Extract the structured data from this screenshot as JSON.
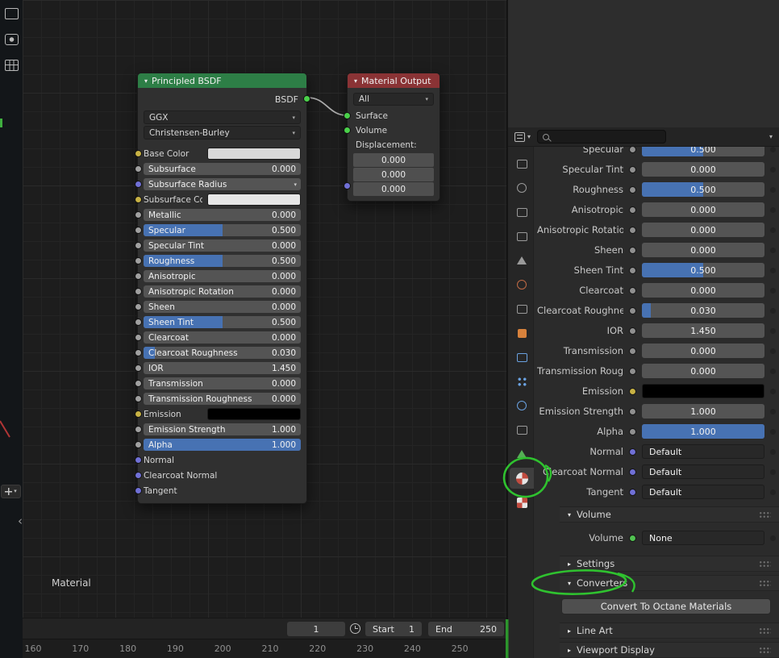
{
  "colors": {
    "accent_blue": "#4772b3",
    "annotation_green": "#2fc22f",
    "node_header_green": "#2d7e46",
    "node_header_red": "#8a3335"
  },
  "left_toolbar": {
    "icons": [
      {
        "name": "printer-icon",
        "shape": "plain"
      },
      {
        "name": "movie-camera-icon",
        "shape": "cam"
      },
      {
        "name": "grid-icon",
        "shape": "grid"
      }
    ]
  },
  "node_editor": {
    "breadcrumb": "Material",
    "principled": {
      "title": "Principled BSDF",
      "output_socket": "BSDF",
      "distribution": "GGX",
      "subsurface_method": "Christensen-Burley",
      "rows": [
        {
          "label": "Base Color",
          "type": "color",
          "swatch": "#d8d8d8",
          "socket": "#c8b244"
        },
        {
          "label": "Subsurface",
          "type": "slider",
          "value": "0.000",
          "fill": 0,
          "socket": "#a0a0a0"
        },
        {
          "label": "Subsurface Radius",
          "type": "vector",
          "socket": "#7070d6"
        },
        {
          "label": "Subsurface Co",
          "type": "color",
          "swatch": "#e6e6e6",
          "socket": "#c8b244"
        },
        {
          "label": "Metallic",
          "type": "slider",
          "value": "0.000",
          "fill": 0,
          "socket": "#a0a0a0"
        },
        {
          "label": "Specular",
          "type": "slider",
          "value": "0.500",
          "fill": 0.5,
          "socket": "#a0a0a0"
        },
        {
          "label": "Specular Tint",
          "type": "slider",
          "value": "0.000",
          "fill": 0,
          "socket": "#a0a0a0"
        },
        {
          "label": "Roughness",
          "type": "slider",
          "value": "0.500",
          "fill": 0.5,
          "socket": "#a0a0a0"
        },
        {
          "label": "Anisotropic",
          "type": "slider",
          "value": "0.000",
          "fill": 0,
          "socket": "#a0a0a0"
        },
        {
          "label": "Anisotropic Rotation",
          "type": "slider",
          "value": "0.000",
          "fill": 0,
          "socket": "#a0a0a0"
        },
        {
          "label": "Sheen",
          "type": "slider",
          "value": "0.000",
          "fill": 0,
          "socket": "#a0a0a0"
        },
        {
          "label": "Sheen Tint",
          "type": "slider",
          "value": "0.500",
          "fill": 0.5,
          "socket": "#a0a0a0"
        },
        {
          "label": "Clearcoat",
          "type": "slider",
          "value": "0.000",
          "fill": 0,
          "socket": "#a0a0a0"
        },
        {
          "label": "Clearcoat Roughness",
          "type": "slider",
          "value": "0.030",
          "fill": 0.07,
          "socket": "#a0a0a0"
        },
        {
          "label": "IOR",
          "type": "slider",
          "value": "1.450",
          "fill": 0,
          "socket": "#a0a0a0"
        },
        {
          "label": "Transmission",
          "type": "slider",
          "value": "0.000",
          "fill": 0,
          "socket": "#a0a0a0"
        },
        {
          "label": "Transmission Roughness",
          "type": "slider",
          "value": "0.000",
          "fill": 0,
          "socket": "#a0a0a0"
        },
        {
          "label": "Emission",
          "type": "color",
          "swatch": "#000000",
          "socket": "#c8b244"
        },
        {
          "label": "Emission Strength",
          "type": "slider",
          "value": "1.000",
          "fill": 0,
          "socket": "#a0a0a0"
        },
        {
          "label": "Alpha",
          "type": "slider",
          "value": "1.000",
          "fill": 1,
          "socket": "#a0a0a0"
        },
        {
          "label": "Normal",
          "type": "label",
          "socket": "#7070d6"
        },
        {
          "label": "Clearcoat Normal",
          "type": "label",
          "socket": "#7070d6"
        },
        {
          "label": "Tangent",
          "type": "label",
          "socket": "#7070d6"
        }
      ]
    },
    "material_output": {
      "title": "Material Output",
      "target": "All",
      "inputs": [
        "Surface",
        "Volume"
      ],
      "displacement_label": "Displacement:",
      "displacement": [
        "0.000",
        "0.000",
        "0.000"
      ]
    }
  },
  "timeline": {
    "current_frame": "1",
    "start": {
      "label": "Start",
      "value": "1"
    },
    "end": {
      "label": "End",
      "value": "250"
    },
    "ruler": [
      "160",
      "170",
      "180",
      "190",
      "200",
      "210",
      "220",
      "230",
      "240",
      "250"
    ]
  },
  "properties": {
    "tabs": [
      {
        "name": "tool",
        "shape": "rect",
        "color": "#9a9a9a",
        "selected": false
      },
      {
        "name": "render",
        "shape": "circle",
        "color": "#9a9a9a",
        "selected": false
      },
      {
        "name": "output",
        "shape": "rect",
        "color": "#9a9a9a",
        "selected": false
      },
      {
        "name": "view-layer",
        "shape": "rect",
        "color": "#9a9a9a",
        "selected": false
      },
      {
        "name": "scene",
        "shape": "triangle",
        "color": "#9a9a9a",
        "selected": false
      },
      {
        "name": "world",
        "shape": "circle",
        "color": "#c06a45",
        "selected": false
      },
      {
        "name": "collection",
        "shape": "rect",
        "color": "#9a9a9a",
        "selected": false
      },
      {
        "name": "object",
        "shape": "square",
        "color": "#d8823c",
        "selected": false
      },
      {
        "name": "modifiers",
        "shape": "rect",
        "color": "#6aa1e0",
        "selected": false
      },
      {
        "name": "particles",
        "shape": "dots",
        "color": "#6aa1e0",
        "selected": false
      },
      {
        "name": "physics",
        "shape": "circle",
        "color": "#6aa1e0",
        "selected": false
      },
      {
        "name": "constraints",
        "shape": "rect",
        "color": "#9a9a9a",
        "selected": false
      },
      {
        "name": "object-data",
        "shape": "triangle",
        "color": "#55b055",
        "selected": false
      },
      {
        "name": "material",
        "shape": "sphere",
        "color": "#c14b3f",
        "selected": true
      },
      {
        "name": "texture",
        "shape": "checker",
        "color": "#c14b3f",
        "selected": false
      }
    ],
    "rows": [
      {
        "label": "Specular",
        "type": "slider",
        "value": "0.500",
        "fill": 0.5,
        "socket": "#909090"
      },
      {
        "label": "Specular Tint",
        "type": "slider",
        "value": "0.000",
        "fill": 0,
        "socket": "#909090"
      },
      {
        "label": "Roughness",
        "type": "slider",
        "value": "0.500",
        "fill": 0.5,
        "socket": "#909090"
      },
      {
        "label": "Anisotropic",
        "type": "slider",
        "value": "0.000",
        "fill": 0,
        "socket": "#909090"
      },
      {
        "label": "Anisotropic Rotation",
        "type": "slider",
        "value": "0.000",
        "fill": 0,
        "socket": "#909090"
      },
      {
        "label": "Sheen",
        "type": "slider",
        "value": "0.000",
        "fill": 0,
        "socket": "#909090"
      },
      {
        "label": "Sheen Tint",
        "type": "slider",
        "value": "0.500",
        "fill": 0.5,
        "socket": "#909090"
      },
      {
        "label": "Clearcoat",
        "type": "slider",
        "value": "0.000",
        "fill": 0,
        "socket": "#909090"
      },
      {
        "label": "Clearcoat Roughnes",
        "type": "slider",
        "value": "0.030",
        "fill": 0.07,
        "socket": "#909090"
      },
      {
        "label": "IOR",
        "type": "slider",
        "value": "1.450",
        "fill": 0,
        "socket": "#909090"
      },
      {
        "label": "Transmission",
        "type": "slider",
        "value": "0.000",
        "fill": 0,
        "socket": "#909090"
      },
      {
        "label": "Transmission Roug...",
        "type": "slider",
        "value": "0.000",
        "fill": 0,
        "socket": "#909090"
      },
      {
        "label": "Emission",
        "type": "color",
        "swatch": "#000000",
        "socket": "#c8b244"
      },
      {
        "label": "Emission Strength",
        "type": "slider",
        "value": "1.000",
        "fill": 0,
        "socket": "#909090"
      },
      {
        "label": "Alpha",
        "type": "slider",
        "value": "1.000",
        "fill": 1,
        "socket": "#909090"
      },
      {
        "label": "Normal",
        "type": "menu",
        "value": "Default",
        "socket": "#7070d6"
      },
      {
        "label": "Clearcoat Normal",
        "type": "menu",
        "value": "Default",
        "socket": "#7070d6"
      },
      {
        "label": "Tangent",
        "type": "menu",
        "value": "Default",
        "socket": "#7070d6"
      }
    ],
    "volume": {
      "header": "Volume",
      "label": "Volume",
      "value": "None",
      "socket": "#51c251"
    },
    "settings_header": "Settings",
    "converters": {
      "header": "Converters",
      "button": "Convert To Octane Materials"
    },
    "line_art_header": "Line Art",
    "viewport_display_header": "Viewport Display"
  }
}
